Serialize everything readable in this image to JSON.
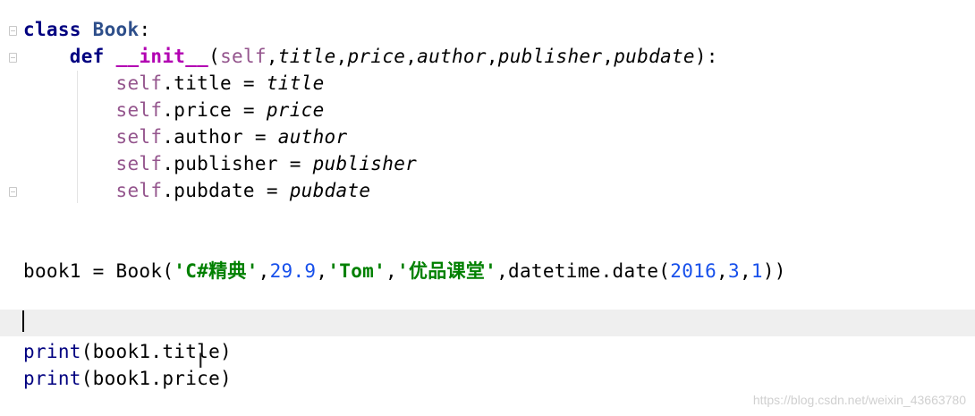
{
  "editor": {
    "lines": {
      "l1": {
        "kw": "class",
        "sp": " ",
        "name": "Book",
        "colon": ":"
      },
      "l2": {
        "indent": "    ",
        "kw": "def",
        "sp": " ",
        "fname": "__init__",
        "open": "(",
        "self": "self",
        "c1": ",",
        "p1": "title",
        "c2": ",",
        "p2": "price",
        "c3": ",",
        "p3": "author",
        "c4": ",",
        "p4": "publisher",
        "c5": ",",
        "p5": "pubdate",
        "close": "):"
      },
      "l3": {
        "indent": "        ",
        "self": "self",
        "attr": ".title = ",
        "val": "title"
      },
      "l4": {
        "indent": "        ",
        "self": "self",
        "attr": ".price = ",
        "val": "price"
      },
      "l5": {
        "indent": "        ",
        "self": "self",
        "attr": ".author = ",
        "val": "author"
      },
      "l6": {
        "indent": "        ",
        "self": "self",
        "attr": ".publisher = ",
        "val": "publisher"
      },
      "l7": {
        "indent": "        ",
        "self": "self",
        "attr": ".pubdate = ",
        "val": "pubdate"
      },
      "l8": {
        "a": "book1 = Book(",
        "s1": "'C#精典'",
        "b": ",",
        "n1": "29.9",
        "c": ",",
        "s2": "'Tom'",
        "d": ",",
        "s3": "'优品课堂'",
        "e": ",datetime.date(",
        "n2": "2016",
        "f": ",",
        "n3": "3",
        "g": ",",
        "n4": "1",
        "h": "))"
      },
      "l9": {
        "fn": "print",
        "rest": "(book1.title)"
      },
      "l10": {
        "fn": "print",
        "rest": "(book1.price)"
      }
    },
    "cursor_glyph": "I",
    "colors": {
      "keyword": "#000080",
      "class_name": "#2d4e8a",
      "dunder": "#b200b2",
      "self": "#94558d",
      "string": "#008000",
      "number": "#1750eb",
      "current_line": "#efefef"
    }
  },
  "watermark": "https://blog.csdn.net/weixin_43663780"
}
